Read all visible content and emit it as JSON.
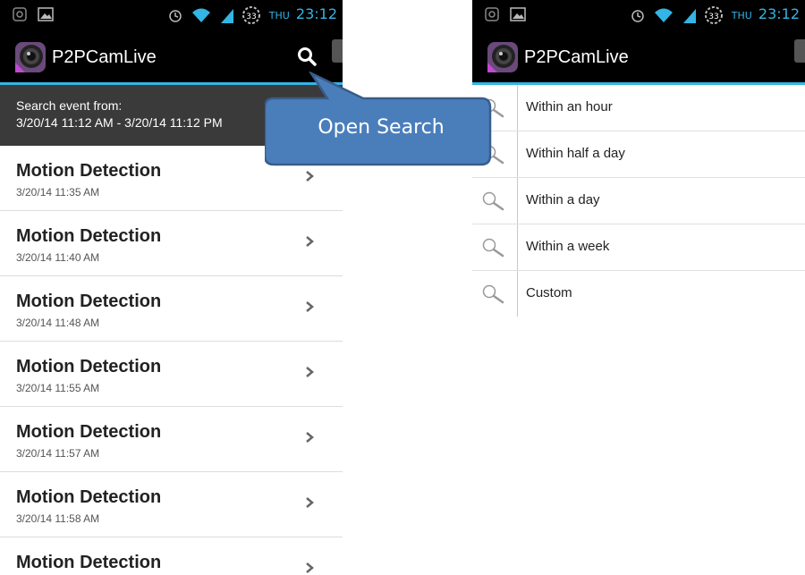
{
  "status_bar": {
    "day": "THU",
    "time": "23:12",
    "battery": "33"
  },
  "app": {
    "title": "P2PCamLive"
  },
  "search_header": {
    "label": "Search event from:",
    "range": "3/20/14 11:12 AM - 3/20/14 11:12 PM"
  },
  "events": [
    {
      "title": "Motion Detection",
      "time": "3/20/14 11:35 AM"
    },
    {
      "title": "Motion Detection",
      "time": "3/20/14 11:40 AM"
    },
    {
      "title": "Motion Detection",
      "time": "3/20/14 11:48 AM"
    },
    {
      "title": "Motion Detection",
      "time": "3/20/14 11:55 AM"
    },
    {
      "title": "Motion Detection",
      "time": "3/20/14 11:57 AM"
    },
    {
      "title": "Motion Detection",
      "time": "3/20/14 11:58 AM"
    },
    {
      "title": "Motion Detection",
      "time": ""
    }
  ],
  "search_menu": [
    {
      "label": "Within an hour"
    },
    {
      "label": "Within half a day"
    },
    {
      "label": "Within a day"
    },
    {
      "label": "Within a week"
    },
    {
      "label": "Custom"
    }
  ],
  "callout": {
    "text": "Open Search"
  },
  "colors": {
    "accent": "#33b5e5",
    "callout_fill": "#4a7ebb",
    "callout_border": "#385d8a"
  }
}
